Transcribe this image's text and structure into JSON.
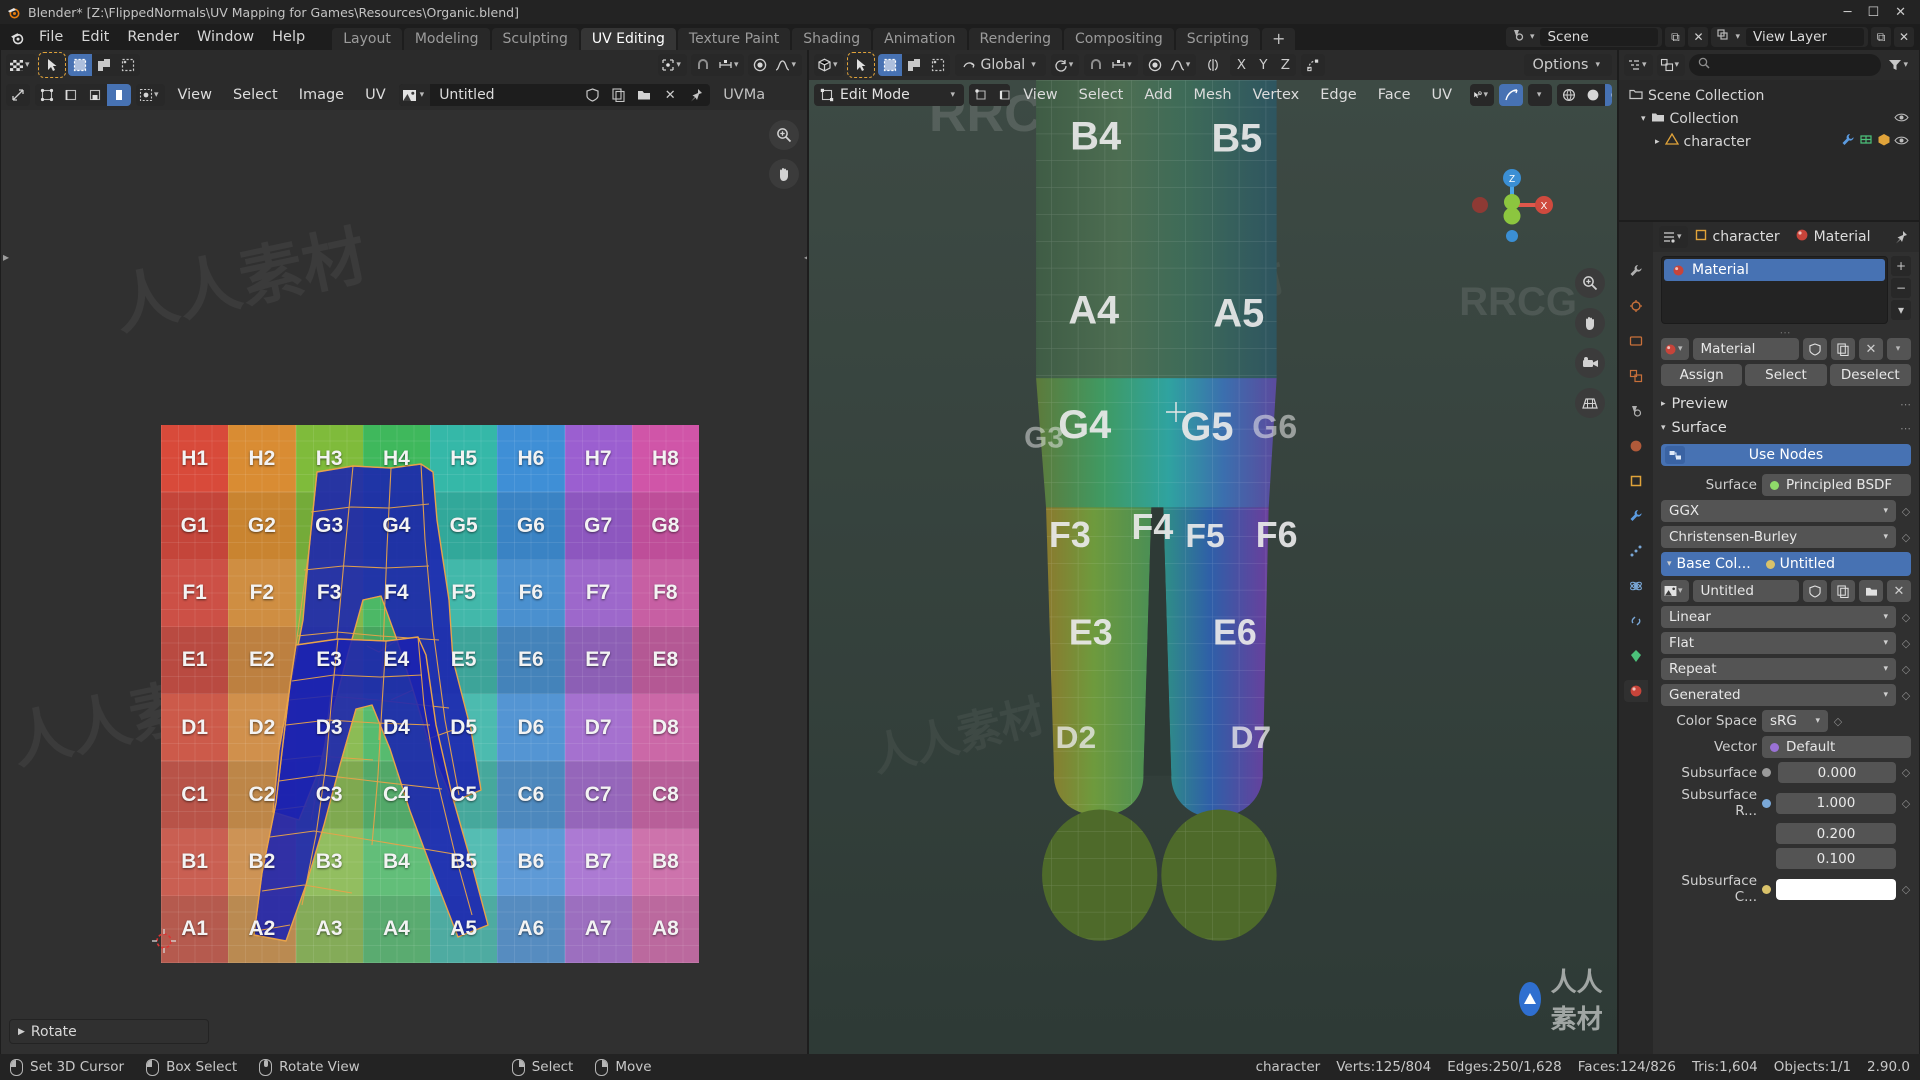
{
  "titlebar": {
    "title": "Blender* [Z:\\FlippedNormals\\UV Mapping for Games\\Resources\\Organic.blend]",
    "logo_icon": "blender-logo-icon",
    "minimize": "─",
    "maximize": "☐",
    "close": "✕"
  },
  "topbar": {
    "app_icon": "blender-icon",
    "menus": [
      "File",
      "Edit",
      "Render",
      "Window",
      "Help"
    ],
    "workspaces": [
      "Layout",
      "Modeling",
      "Sculpting",
      "UV Editing",
      "Texture Paint",
      "Shading",
      "Animation",
      "Rendering",
      "Compositing",
      "Scripting"
    ],
    "active_workspace": "UV Editing",
    "add_workspace": "+",
    "scene_icon": "scene-icon",
    "scene_name": "Scene",
    "new_scene_icon": "copy-icon",
    "delete_scene_icon": "x-icon",
    "viewlayer_icon": "viewlayer-icon",
    "viewlayer_name": "View Layer",
    "viewlayer_new_icon": "copy-icon",
    "viewlayer_delete_icon": "x-icon"
  },
  "uv_editor": {
    "editor_type_icon": "uv-editor-icon",
    "tool_cursor_icon": "cursor-tool-icon",
    "select_modes": [
      "tweak-select-icon",
      "select-box-icon",
      "select-lasso-icon"
    ],
    "pivot_icon": "pivot-center-icon",
    "snap_magnet_icon": "magnet-icon",
    "snap_increment_icon": "snap-increment-icon",
    "prop_edit_icon": "proportional-edit-icon",
    "falloff_icon": "smooth-falloff-icon",
    "uv_sync_icon": "uv-sync-selection-icon",
    "uv_select_modes": [
      "vertex-select-icon",
      "edge-select-icon",
      "face-select-icon",
      "island-select-icon"
    ],
    "sticky_icon": "sticky-selection-icon",
    "menus": [
      "View",
      "Select",
      "Image",
      "UV"
    ],
    "image_icon": "image-datablock-icon",
    "image_name": "Untitled",
    "fake_user_icon": "shield-icon",
    "new_image_icon": "new-copy-icon",
    "open_image_icon": "folder-icon",
    "unlink_icon": "x-icon",
    "pin_icon": "pin-icon",
    "uvmap_label": "UVMa",
    "zoom_icon": "zoom-icon",
    "pan_icon": "hand-icon",
    "status_operator": "Rotate",
    "status_operator_icon": "triangle-right-icon",
    "checker": {
      "rows": [
        [
          {
            "t": "H1",
            "c": "#d84a3a"
          },
          {
            "t": "H2",
            "c": "#d98c33"
          },
          {
            "t": "H3",
            "c": "#7fbb3b"
          },
          {
            "t": "H4",
            "c": "#3fb85c"
          },
          {
            "t": "H5",
            "c": "#35b8a8"
          },
          {
            "t": "H6",
            "c": "#3f8fd6"
          },
          {
            "t": "H7",
            "c": "#9b5fd0"
          },
          {
            "t": "H8",
            "c": "#d055a8"
          }
        ],
        [
          {
            "t": "G1",
            "c": "#c4453a"
          },
          {
            "t": "G2",
            "c": "#c98430"
          },
          {
            "t": "G3",
            "c": "#74ab39"
          },
          {
            "t": "G4",
            "c": "#3ba854"
          },
          {
            "t": "G5",
            "c": "#32a89a"
          },
          {
            "t": "G6",
            "c": "#3a83c4"
          },
          {
            "t": "G7",
            "c": "#8d57bf"
          },
          {
            "t": "G8",
            "c": "#be4e99"
          }
        ],
        [
          {
            "t": "F1",
            "c": "#cc5046"
          },
          {
            "t": "F2",
            "c": "#cf8e42"
          },
          {
            "t": "F3",
            "c": "#84b94b"
          },
          {
            "t": "F4",
            "c": "#4cb866"
          },
          {
            "t": "F5",
            "c": "#42b8aa"
          },
          {
            "t": "F6",
            "c": "#4a90cf",
            "n": "F6"
          },
          {
            "t": "F7",
            "c": "#9d68cb"
          },
          {
            "t": "F8",
            "c": "#c75fa3"
          }
        ],
        [
          {
            "t": "E1",
            "c": "#b94a41"
          },
          {
            "t": "E2",
            "c": "#bd8040"
          },
          {
            "t": "E3",
            "c": "#76a648"
          },
          {
            "t": "E4",
            "c": "#47a55f"
          },
          {
            "t": "E5",
            "c": "#3da499"
          },
          {
            "t": "E6",
            "c": "#4483ba"
          },
          {
            "t": "E7",
            "c": "#8c5fb5"
          },
          {
            "t": "E8",
            "c": "#b45894"
          }
        ],
        [
          {
            "t": "D1",
            "c": "#cc5a4a"
          },
          {
            "t": "D2",
            "c": "#d0904c"
          },
          {
            "t": "D3",
            "c": "#8cbc55"
          },
          {
            "t": "D4",
            "c": "#57bb6f"
          },
          {
            "t": "D5",
            "c": "#4cbbaf"
          },
          {
            "t": "D6",
            "c": "#5495d3"
          },
          {
            "t": "D7",
            "c": "#a571cf"
          },
          {
            "t": "D8",
            "c": "#cb68a7"
          }
        ],
        [
          {
            "t": "C1",
            "c": "#b85348"
          },
          {
            "t": "C2",
            "c": "#bd8648"
          },
          {
            "t": "C3",
            "c": "#7fa950"
          },
          {
            "t": "C4",
            "c": "#52a868"
          },
          {
            "t": "C5",
            "c": "#46a89c"
          },
          {
            "t": "C6",
            "c": "#4d88bd"
          },
          {
            "t": "C7",
            "c": "#9566ba"
          },
          {
            "t": "C8",
            "c": "#b85f99"
          }
        ],
        [
          {
            "t": "B1",
            "c": "#c95f52"
          },
          {
            "t": "B2",
            "c": "#cd9355"
          },
          {
            "t": "B3",
            "c": "#92be60"
          },
          {
            "t": "B4",
            "c": "#62be79"
          },
          {
            "t": "B5",
            "c": "#55bdb3"
          },
          {
            "t": "B6",
            "c": "#5e9ad6"
          },
          {
            "t": "B7",
            "c": "#ac7ad3"
          },
          {
            "t": "B8",
            "c": "#cd73ac"
          }
        ],
        [
          {
            "t": "A1",
            "c": "#b55a4e"
          },
          {
            "t": "A2",
            "c": "#ba8a51"
          },
          {
            "t": "A3",
            "c": "#84ab58"
          },
          {
            "t": "A4",
            "c": "#5aab70"
          },
          {
            "t": "A5",
            "c": "#4eaba1"
          },
          {
            "t": "A6",
            "c": "#568cc0"
          },
          {
            "t": "A7",
            "c": "#9c6fbf"
          },
          {
            "t": "A8",
            "c": "#bb699e"
          }
        ]
      ]
    }
  },
  "viewport": {
    "editor_type_icon": "3d-viewport-icon",
    "mode": "Edit Mode",
    "mode_icon": "edit-mode-icon",
    "select_modes": [
      "vertex-select-icon",
      "edge-select-icon",
      "face-select-icon"
    ],
    "active_select_mode": "face-select-icon",
    "menus": [
      "View",
      "Select",
      "Add",
      "Mesh",
      "Vertex",
      "Edge",
      "Face",
      "UV"
    ],
    "transform_orientation": "Global",
    "orientation_icon": "orientation-icon",
    "pivot_icon": "pivot-point-icon",
    "snap_icon": "magnet-icon",
    "snap_to_icon": "snap-increment-icon",
    "prop_edit_icon": "proportional-edit-icon",
    "falloff_icon": "smooth-falloff-icon",
    "mirror_icon": "mirror-icon",
    "mirror_axes": [
      "X",
      "Y",
      "Z"
    ],
    "auto_merge_icon": "auto-merge-icon",
    "options_label": "Options",
    "visibility_icon": "mesh-visibility-icon",
    "xray_icon": "xray-toggle-icon",
    "shading_icons": [
      "wireframe-shading-icon",
      "solid-shading-icon",
      "material-shading-icon",
      "rendered-shading-icon"
    ],
    "gizmo_axes": [
      "Z",
      "X",
      "Y"
    ],
    "side_icons": [
      "zoom-icon",
      "hand-icon",
      "camera-icon",
      "grid-icon"
    ],
    "cursor_3d_icon": "3d-cursor-icon"
  },
  "outliner": {
    "editor_type_icon": "outliner-icon",
    "display_mode_icon": "view-layer-icon",
    "search_placeholder": "",
    "search_icon": "search-icon",
    "filter_icon": "filter-icon",
    "filter_caret": "▾",
    "rows": [
      {
        "label": "Scene Collection",
        "icon": "collection-icon",
        "indent": 0,
        "expander": "",
        "eye": false
      },
      {
        "label": "Collection",
        "icon": "collection-icon",
        "indent": 1,
        "expander": "▾",
        "eye": true
      },
      {
        "label": "character",
        "icon": "mesh-object-icon",
        "indent": 2,
        "expander": "▸",
        "eye": true,
        "right_icons": [
          "wrench-icon",
          "mesh-data-icon",
          "material-icon"
        ]
      }
    ]
  },
  "properties": {
    "editor_type_icon": "properties-icon",
    "tabs": [
      "tool-icon",
      "render-icon",
      "output-icon",
      "view-layer-icon",
      "scene-icon",
      "world-icon",
      "object-icon",
      "modifier-icon",
      "particles-icon",
      "physics-icon",
      "constraints-icon",
      "data-icon",
      "material-icon"
    ],
    "active_tab": "material-icon",
    "breadcrumb_object": "character",
    "breadcrumb_object_icon": "object-icon",
    "breadcrumb_material": "Material",
    "breadcrumb_material_icon": "material-sphere-icon",
    "pin_icon": "pin-icon",
    "material_slot": "Material",
    "slot_add_icon": "+",
    "slot_remove_icon": "−",
    "slot_menu_icon": "▾",
    "browse_icon": "material-browse-icon",
    "material_name": "Material",
    "fake_user_icon": "shield-icon",
    "new_material_icon": "new-copy-icon",
    "unlink_icon": "x-icon",
    "assign_label": "Assign",
    "select_label": "Select",
    "deselect_label": "Deselect",
    "preview_label": "Preview",
    "surface_label": "Surface",
    "use_nodes_label": "Use Nodes",
    "use_nodes_icon": "nodes-icon",
    "surface_field_label": "Surface",
    "surface_value": "Principled BSDF",
    "distribution_value": "GGX",
    "subsurface_method_value": "Christensen-Burley",
    "base_color_label": "Base Col...",
    "base_color_value": "Untitled",
    "image_icon": "image-datablock-icon",
    "image_name": "Untitled",
    "open_icon": "folder-icon",
    "interpolation_value": "Linear",
    "projection_value": "Flat",
    "extension_value": "Repeat",
    "source_value": "Generated",
    "color_space_label": "Color Space",
    "color_space_value": "sRG",
    "vector_label": "Vector",
    "vector_value": "Default",
    "subsurface_label": "Subsurface",
    "subsurface_value": "0.000",
    "subsurface_radius_label": "Subsurface R...",
    "subsurface_radius_values": [
      "1.000",
      "0.200",
      "0.100"
    ],
    "subsurface_color_label": "Subsurface C...",
    "subsurface_color_hex": "#ffffff"
  },
  "statusbar": {
    "items": [
      {
        "icon": "mouse-left-icon",
        "label": "Set 3D Cursor"
      },
      {
        "icon": "mouse-left-drag-icon",
        "label": "Box Select"
      },
      {
        "icon": "mouse-middle-icon",
        "label": "Rotate View"
      },
      {
        "icon": "mouse-right-icon",
        "label": "Select"
      },
      {
        "icon": "mouse-right-drag-icon",
        "label": "Move"
      }
    ],
    "stats": [
      "character",
      "Verts:125/804",
      "Edges:250/1,628",
      "Faces:124/826",
      "Tris:1,604",
      "Objects:1/1",
      "2.90.0"
    ]
  },
  "watermarks": {
    "brand_top": "RRCG.CN",
    "brand_mid": "RRCG",
    "cn_text": "人人素材",
    "logo_text": "人人素材"
  },
  "colors": {
    "accent_blue": "#4772b3",
    "header_bg": "#2b2b2b",
    "panel_bg": "#303030",
    "field_bg": "#545454",
    "orange_outline": "#e0a33a",
    "uv_face": "#1b22b0",
    "uv_edge": "#e8a34a"
  }
}
